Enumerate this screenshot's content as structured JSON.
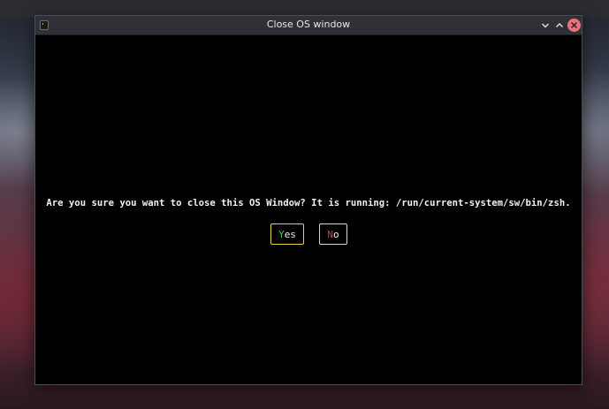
{
  "window": {
    "title": "Close OS window",
    "app_icon": "terminal-icon",
    "controls": [
      "minimize-icon",
      "maximize-icon",
      "close-icon"
    ]
  },
  "dialog": {
    "message": "Are you sure you want to close this OS Window? It is running: /run/current-system/sw/bin/zsh.",
    "yes": {
      "hotkey": "Y",
      "rest": "es"
    },
    "no": {
      "hotkey": "N",
      "rest": "o"
    }
  },
  "colors": {
    "yes_hotkey": "#3fd13f",
    "no_hotkey": "#e23b2f",
    "yes_border": "#e8d33a",
    "no_border": "#d8d8d8",
    "close_button": "#e9737f"
  }
}
